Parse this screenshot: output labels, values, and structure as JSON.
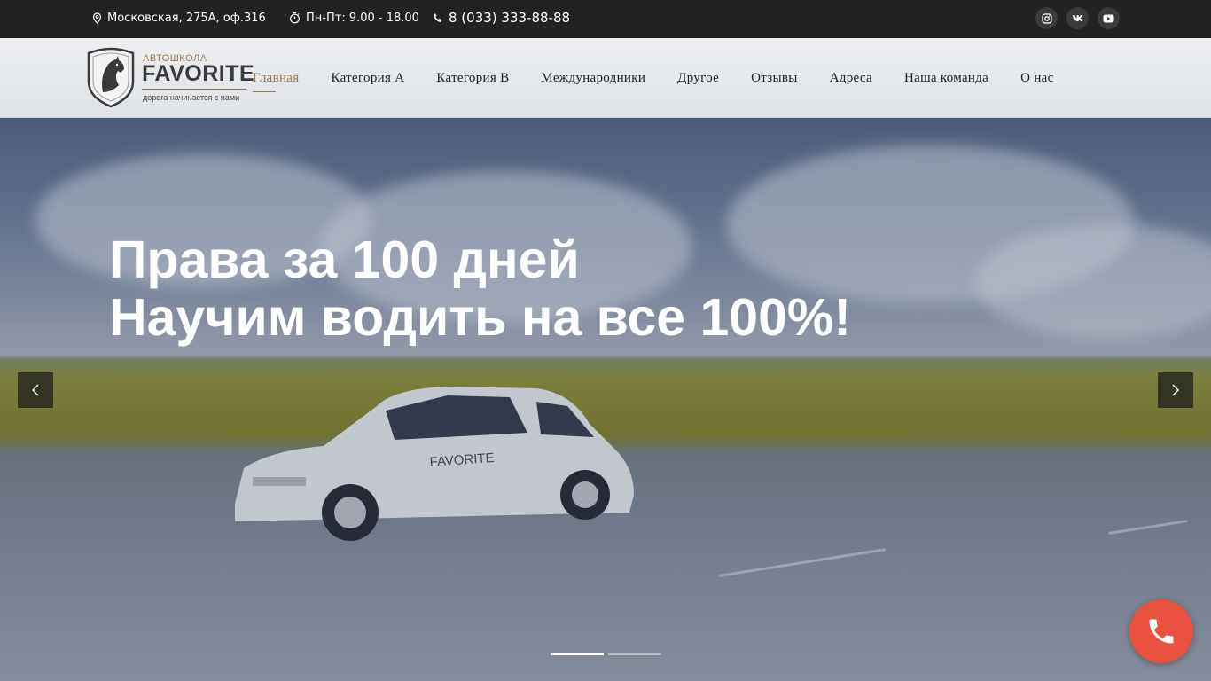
{
  "topbar": {
    "address": "Московская, 275А, оф.316",
    "hours": "Пн-Пт: 9.00 - 18.00",
    "phone": "8 (033) 333-88-88",
    "socials": [
      {
        "icon": "instagram-icon"
      },
      {
        "icon": "vk-icon"
      },
      {
        "icon": "youtube-icon"
      }
    ]
  },
  "logo": {
    "sub": "АВТОШКОЛА",
    "title": "FAVORITE",
    "tagline": "дорога начинается с нами"
  },
  "nav": {
    "items": [
      {
        "label": "Главная",
        "active": true
      },
      {
        "label": "Категория А"
      },
      {
        "label": "Категория В"
      },
      {
        "label": "Международники"
      },
      {
        "label": "Другое"
      },
      {
        "label": "Отзывы"
      },
      {
        "label": "Адреса"
      },
      {
        "label": "Наша команда"
      },
      {
        "label": "О нас"
      }
    ]
  },
  "hero": {
    "line1": "Права за 100 дней",
    "line2": "Научим водить на все 100%!",
    "car_text": "FAVORITE",
    "slides_total": 2,
    "active_slide": 1
  },
  "colors": {
    "accent": "#9b7a4e",
    "topbar": "#222222",
    "call": "#e8523f"
  }
}
